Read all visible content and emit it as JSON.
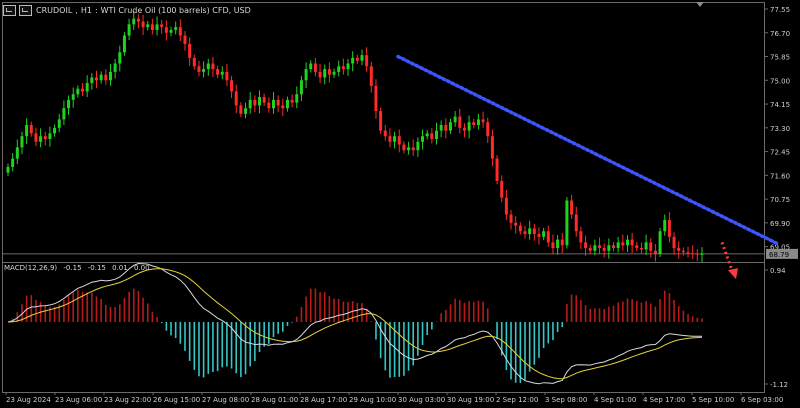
{
  "header": {
    "symbol": "CRUDOIL",
    "timeframe": "H1",
    "description": "WTI Crude Oil (100 barrels) CFD, USD"
  },
  "macd_label": {
    "name": "MACD(12,26,9)",
    "v1": "-0.15",
    "v2": "-0.15",
    "v3": "0.01",
    "v4": "0.00"
  },
  "colors": {
    "background": "#000000",
    "bull": "#1fd41f",
    "bear": "#ff2a2a",
    "trendline": "#3b55ff",
    "projection": "#ff3a3a",
    "macd_hist_pos": "#b81a1a",
    "macd_hist_neg": "#35c6c6",
    "macd_line": "#d9d9d9",
    "signal_line": "#e6d23a",
    "grid": "#6a6a6a"
  },
  "chart_data": [
    {
      "type": "candlestick",
      "title": "CRUDOIL, H1: WTI Crude Oil (100 barrels) CFD, USD",
      "ylim": [
        68.5,
        77.8
      ],
      "y_ticks": [
        "77.55",
        "76.70",
        "75.85",
        "75.00",
        "74.15",
        "73.30",
        "72.45",
        "71.60",
        "70.75",
        "69.90",
        "69.05"
      ],
      "x_tick_labels": [
        "23 Aug 2024",
        "23 Aug 06:00",
        "23 Aug 22:00",
        "26 Aug 15:00",
        "27 Aug 08:00",
        "28 Aug 01:00",
        "28 Aug 17:00",
        "29 Aug 10:00",
        "30 Aug 03:00",
        "30 Aug 19:00",
        "2 Sep 12:00",
        "3 Sep 08:00",
        "4 Sep 01:00",
        "4 Sep 17:00",
        "5 Sep 10:00",
        "6 Sep 03:00"
      ],
      "current_price": "68.79",
      "close_series": [
        71.9,
        72.2,
        72.6,
        73.0,
        73.4,
        73.1,
        72.8,
        73.0,
        72.9,
        73.1,
        73.3,
        73.6,
        74.0,
        74.3,
        74.5,
        74.7,
        74.6,
        74.9,
        75.1,
        75.0,
        75.2,
        75.0,
        75.3,
        75.6,
        76.0,
        76.6,
        77.0,
        77.2,
        77.1,
        76.9,
        77.0,
        76.8,
        77.0,
        76.9,
        76.7,
        76.8,
        76.9,
        76.6,
        76.3,
        75.8,
        75.5,
        75.3,
        75.4,
        75.6,
        75.4,
        75.2,
        75.3,
        75.0,
        74.6,
        74.1,
        73.8,
        74.0,
        74.3,
        74.1,
        74.4,
        74.2,
        74.0,
        74.3,
        74.1,
        74.0,
        74.3,
        74.2,
        74.5,
        75.0,
        75.4,
        75.6,
        75.3,
        75.1,
        75.4,
        75.2,
        75.3,
        75.5,
        75.4,
        75.6,
        75.8,
        75.7,
        75.9,
        75.5,
        74.8,
        73.9,
        73.2,
        73.0,
        72.8,
        73.0,
        72.7,
        72.5,
        72.6,
        72.5,
        72.8,
        73.0,
        73.1,
        72.9,
        73.2,
        73.4,
        73.2,
        73.5,
        73.7,
        73.3,
        73.2,
        73.5,
        73.4,
        73.6,
        73.5,
        73.0,
        72.2,
        71.4,
        70.8,
        70.2,
        69.9,
        69.8,
        69.6,
        69.5,
        69.7,
        69.5,
        69.4,
        69.6,
        69.2,
        69.0,
        69.3,
        69.1,
        70.7,
        70.2,
        69.6,
        69.2,
        69.0,
        68.9,
        69.1,
        69.0,
        68.9,
        69.1,
        69.0,
        69.2,
        69.1,
        69.3,
        69.1,
        69.0,
        68.95,
        69.2,
        68.9,
        68.8,
        69.6,
        70.0,
        69.4,
        69.0,
        68.9,
        68.85,
        68.82,
        68.8,
        68.78,
        68.79
      ],
      "trendline": {
        "from": [
          "30 Aug 03:00",
          75.85
        ],
        "to": [
          "6 Sep 03:00",
          69.8
        ]
      },
      "projection": {
        "from": 69.2,
        "to": 68.1
      }
    },
    {
      "type": "macd",
      "name": "MACD(12,26,9)",
      "ylim": [
        -1.12,
        0.94
      ],
      "y_ticks": [
        "0.94",
        "-1.12"
      ],
      "signal_period": 9
    }
  ]
}
